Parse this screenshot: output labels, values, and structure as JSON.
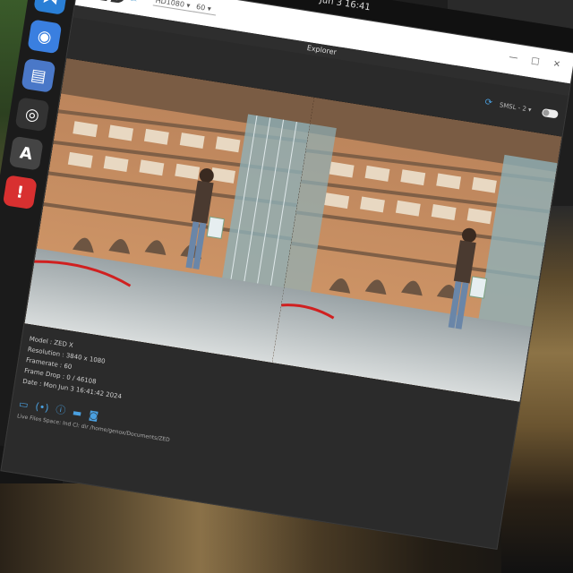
{
  "topbar": {
    "clock": "Jun 3  16:41",
    "status_icons": "⏻ ◔ ▾"
  },
  "dock": {
    "items": [
      {
        "name": "vscode-icon",
        "glyph": "⋊",
        "color": "#2a7fd6"
      },
      {
        "name": "chromium-icon",
        "glyph": "◉",
        "color": "#3a7fe0"
      },
      {
        "name": "text-editor-icon",
        "glyph": "▤",
        "color": "#4a78c8"
      },
      {
        "name": "obs-icon",
        "glyph": "◎",
        "color": "#333333"
      },
      {
        "name": "inkscape-icon",
        "glyph": "A",
        "color": "#444444"
      },
      {
        "name": "warning-icon",
        "glyph": "!",
        "color": "#d83030"
      }
    ]
  },
  "window": {
    "logo": "ZED",
    "logo_sub": "Ex",
    "resolution": "HD1080",
    "fps": "60",
    "controls": "— □ ✕",
    "title": "Explorer"
  },
  "controls": {
    "stream_label": "SMSL - 2",
    "ctl_icon": "⟳"
  },
  "camera_info": {
    "model": "Model : ZED X",
    "resolution": "Resolution : 3840 x 1080",
    "framerate": "Framerate : 60",
    "frame_drop": "Frame Drop : 0 / 46108",
    "date": "Date : Mon Jun 3 16:41:42 2024"
  },
  "footer": {
    "actions": [
      {
        "name": "open-folder-icon",
        "glyph": "▭"
      },
      {
        "name": "record-icon",
        "glyph": "(•)"
      },
      {
        "name": "info-icon",
        "glyph": "ⓘ"
      },
      {
        "name": "svo-icon",
        "glyph": "▬"
      },
      {
        "name": "snapshot-icon",
        "glyph": "◙"
      }
    ],
    "save_path": "Live Files Space: Ind Cl: dir /home/genox/Documents/ZED"
  },
  "colors": {
    "accent": "#4aa0e0",
    "header_bg": "#ffffff",
    "window_bg": "#2b2b2b"
  }
}
